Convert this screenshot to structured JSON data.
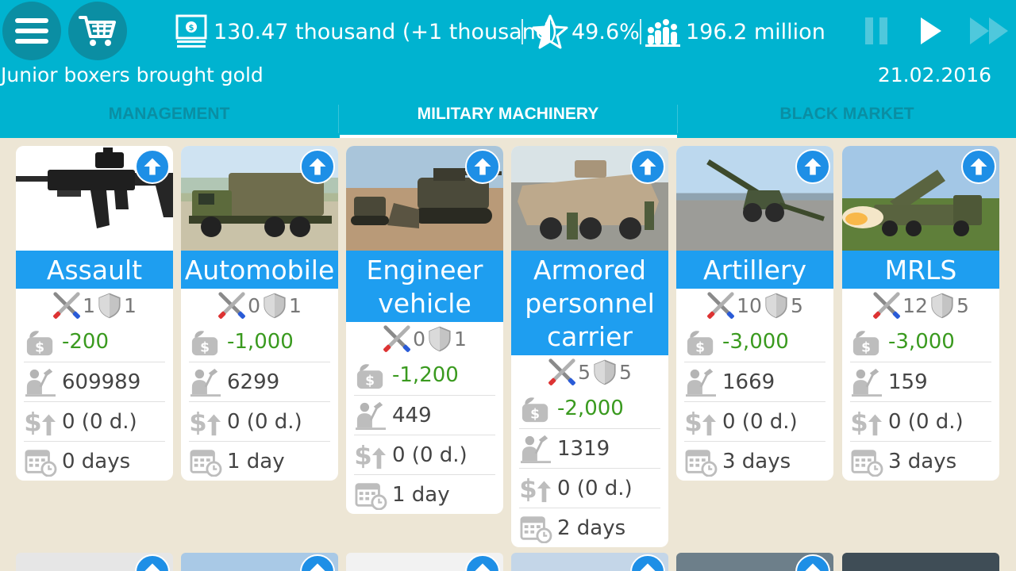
{
  "top": {
    "money": "130.47 thousand (+1 thousand)",
    "rating": "49.6%",
    "population": "196.2 million",
    "news": "Junior boxers brought gold",
    "date": "21.02.2016"
  },
  "tabs": [
    {
      "label": "MANAGEMENT"
    },
    {
      "label": "MILITARY MACHINERY"
    },
    {
      "label": "BLACK MARKET"
    }
  ],
  "cards": [
    {
      "name": "Assault rifle",
      "attack": "1",
      "defense": "1",
      "cost": "-200",
      "count": "609989",
      "income": "0 (0 d.)",
      "time": "0 days"
    },
    {
      "name": "Automobile",
      "attack": "0",
      "defense": "1",
      "cost": "-1,000",
      "count": "6299",
      "income": "0 (0 d.)",
      "time": "1 day"
    },
    {
      "name": "Engineer vehicle",
      "attack": "0",
      "defense": "1",
      "cost": "-1,200",
      "count": "449",
      "income": "0 (0 d.)",
      "time": "1 day"
    },
    {
      "name": "Armored personnel carrier",
      "attack": "5",
      "defense": "5",
      "cost": "-2,000",
      "count": "1319",
      "income": "0 (0 d.)",
      "time": "2 days"
    },
    {
      "name": "Artillery",
      "attack": "10",
      "defense": "5",
      "cost": "-3,000",
      "count": "1669",
      "income": "0 (0 d.)",
      "time": "3 days"
    },
    {
      "name": "MRLS",
      "attack": "12",
      "defense": "5",
      "cost": "-3,000",
      "count": "159",
      "income": "0 (0 d.)",
      "time": "3 days"
    }
  ],
  "colors": {
    "topbar": "#00b3d0",
    "title_bar": "#1e9ef0",
    "background": "#ede6d5",
    "cost_green": "#3a9a1f"
  }
}
